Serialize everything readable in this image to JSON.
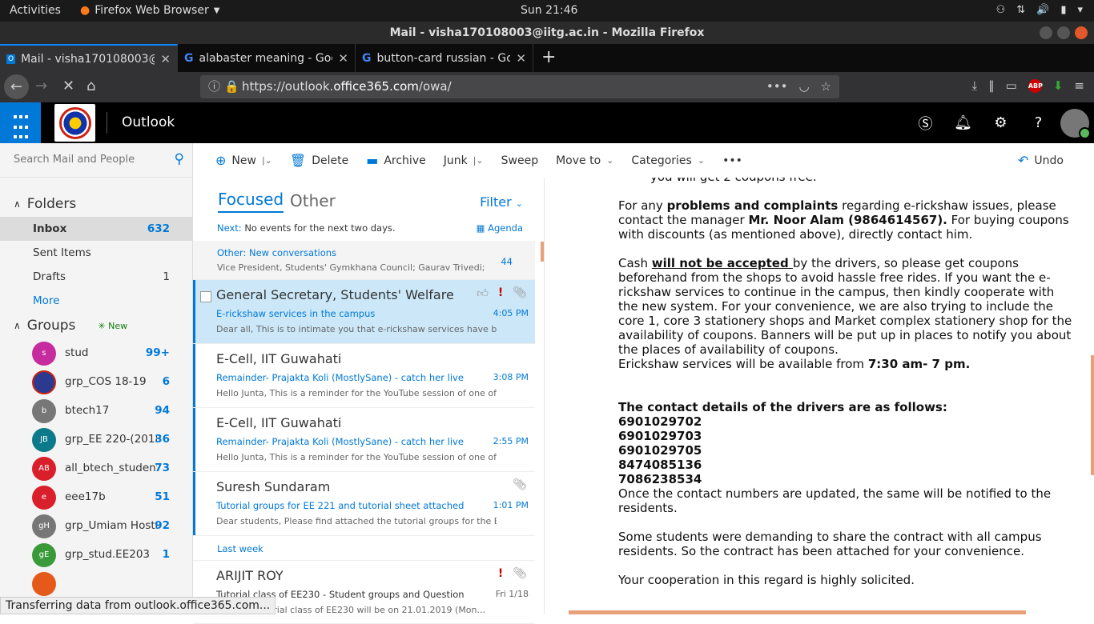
{
  "system": {
    "activities": "Activities",
    "app_name": "Firefox Web Browser",
    "clock": "Sun 21:46"
  },
  "window": {
    "title": "Mail - visha170108003@iitg.ac.in - Mozilla Firefox"
  },
  "tabs": [
    {
      "title": "Mail - visha170108003@i"
    },
    {
      "title": "alabaster meaning - Goo"
    },
    {
      "title": "button-card russian - Go"
    }
  ],
  "url": {
    "prefix": "https://outlook.",
    "domain": "office365.com",
    "path": "/owa/"
  },
  "owa": {
    "brand": "Outlook"
  },
  "search": {
    "placeholder": "Search Mail and People"
  },
  "folders": {
    "header": "Folders",
    "items": [
      {
        "label": "Inbox",
        "count": "632"
      },
      {
        "label": "Sent Items",
        "count": ""
      },
      {
        "label": "Drafts",
        "count": "1"
      }
    ],
    "more": "More"
  },
  "groups": {
    "header": "Groups",
    "new_badge": "New",
    "items": [
      {
        "initials": "s",
        "name": "stud",
        "count": "99+",
        "color": "#c72c9e"
      },
      {
        "initials": "",
        "name": "grp_COS 18-19",
        "count": "6",
        "color": "#2b3a8f"
      },
      {
        "initials": "b",
        "name": "btech17",
        "count": "94",
        "color": "#777777"
      },
      {
        "initials": "JB",
        "name": "grp_EE 220-(2018 Jul",
        "count": "36",
        "color": "#0b7a8a"
      },
      {
        "initials": "AB",
        "name": "all_btech_students",
        "count": "73",
        "color": "#d9202a"
      },
      {
        "initials": "e",
        "name": "eee17b",
        "count": "51",
        "color": "#d9202a"
      },
      {
        "initials": "gH",
        "name": "grp_Umiam Hostel",
        "count": "92",
        "color": "#777777"
      },
      {
        "initials": "gE",
        "name": "grp_stud.EE203",
        "count": "1",
        "color": "#3a9a3a"
      }
    ]
  },
  "toolbar": {
    "new": "New",
    "delete": "Delete",
    "archive": "Archive",
    "junk": "Junk",
    "sweep": "Sweep",
    "move_to": "Move to",
    "categories": "Categories",
    "more": "•••",
    "undo": "Undo"
  },
  "list": {
    "focused": "Focused",
    "other": "Other",
    "filter": "Filter",
    "next_label": "Next:",
    "next_text": "No events for the next two days.",
    "agenda": "Agenda",
    "other_banner": {
      "title": "Other: New conversations",
      "preview": "Vice President, Students' Gymkhana Council; Gaurav Trivedi; S...",
      "count": "44"
    },
    "messages": [
      {
        "from": "General Secretary, Students' Welfare B...",
        "subject": "E-rickshaw services in the campus",
        "preview": "Dear all, This is to intimate you that e-rickshaw services have been...",
        "time": "4:05 PM"
      },
      {
        "from": "E-Cell, IIT Guwahati",
        "subject": "Remainder- Prajakta Koli (MostlySane) - catch her live at 5:",
        "preview": "Hello Junta, This is a reminder for the YouTube session of one of t...",
        "time": "3:08 PM"
      },
      {
        "from": "E-Cell, IIT Guwahati",
        "subject": "Remainder- Prajakta Koli (MostlySane) - catch her live at 5:",
        "preview": "Hello Junta, This is a reminder for the YouTube session of one of t...",
        "time": "2:55 PM"
      },
      {
        "from": "Suresh Sundaram",
        "subject": "Tutorial groups for EE 221 and tutorial sheet attached",
        "preview": "Dear students, Please find attached the tutorial groups for the EE ...",
        "time": "1:01 PM"
      }
    ],
    "last_week": "Last week",
    "old_message": {
      "from": "ARIJIT ROY",
      "subject": "Tutorial class of EE230 - Student groups and Question paper",
      "preview": "The first tutorial class of EE230 will be on 21.01.2019 (Mon...",
      "time": "Fri 1/18"
    }
  },
  "reading": {
    "p0": "you will get 2 coupons free.",
    "p1a": "For any ",
    "p1b": "problems and complaints",
    "p1c": " regarding e-rickshaw issues, please contact the manager ",
    "p1d": "Mr. Noor Alam (9864614567).",
    "p1e": " For buying coupons with discounts (as mentioned above), directly contact him.",
    "p2a": "Cash ",
    "p2b": "will not be accepted ",
    "p2c": "by the drivers, so please get coupons beforehand from the shops to avoid hassle free rides. If you want the e-rickshaw services to continue in the campus, then kindly cooperate with the new system. For your convenience, we are also trying to include the core 1, core 3 stationery shops and Market complex stationery shop for the availability of coupons. Banners will be put up in places to notify you about the places of availability of coupons.",
    "p2d": "Erickshaw services will be available from ",
    "p2e": "7:30 am- 7 pm.",
    "contact_head": "The contact details of the drivers are as follows:",
    "phones": [
      "6901029702",
      "6901029703",
      "6901029705",
      "8474085136",
      "7086238534"
    ],
    "p3": "Once the contact numbers are updated, the same will be notified to the residents.",
    "p4": "Some students were demanding to share the contract with all campus residents. So the contract has been attached for your convenience.",
    "p5": "Your cooperation in this regard is highly solicited."
  },
  "status": "Transferring data from outlook.office365.com..."
}
